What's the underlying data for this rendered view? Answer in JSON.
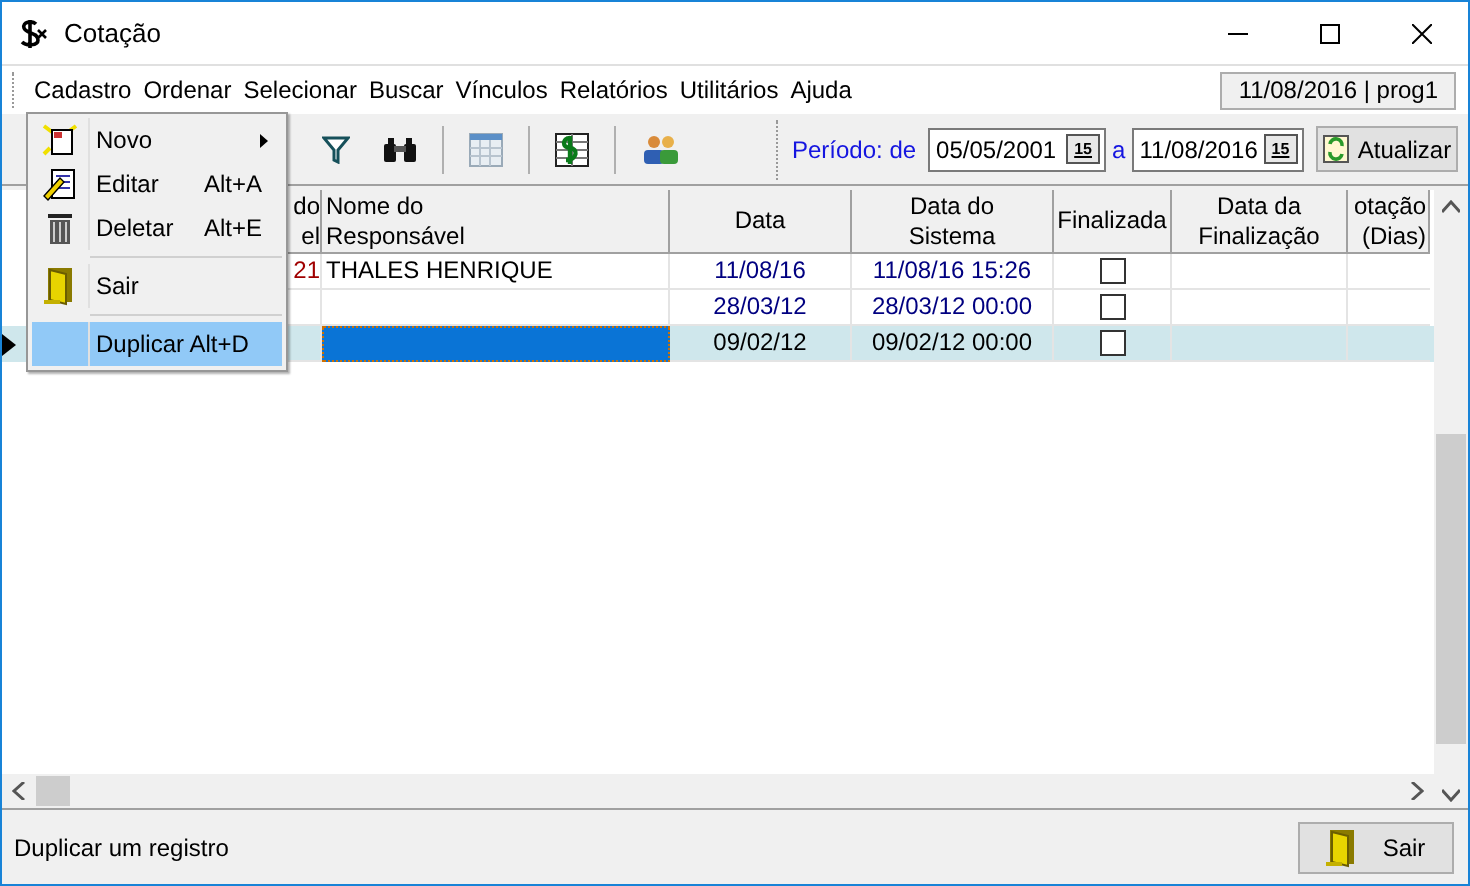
{
  "window": {
    "title": "Cotação"
  },
  "menu_bar": [
    {
      "label": "Cadastro"
    },
    {
      "label": "Ordenar"
    },
    {
      "label": "Selecionar"
    },
    {
      "label": "Buscar"
    },
    {
      "label": "Vínculos"
    },
    {
      "label": "Relatórios"
    },
    {
      "label": "Utilitários"
    },
    {
      "label": "Ajuda"
    }
  ],
  "session_label": "11/08/2016 | prog1",
  "period": {
    "label": "Período: de",
    "from": "05/05/2001",
    "from_calendar": "15",
    "separator": "a",
    "to": "11/08/2016",
    "to_calendar": "15",
    "refresh_button": "Atualizar"
  },
  "grid": {
    "columns": [
      [
        "do",
        "el"
      ],
      [
        "Nome do",
        "Responsável"
      ],
      [
        "Data"
      ],
      [
        "Data do",
        "Sistema"
      ],
      [
        "Finalizada"
      ],
      [
        "Data da",
        "Finalização"
      ],
      [
        "otação",
        "(Dias)"
      ]
    ],
    "rows": [
      {
        "current": false,
        "selected": false,
        "editing": false,
        "column_1": "21",
        "responsavel": "THALES HENRIQUE",
        "data": "11/08/16",
        "data_sistema": "11/08/16 15:26",
        "finalizada": false
      },
      {
        "current": false,
        "selected": false,
        "editing": false,
        "data": "28/03/12",
        "data_sistema": "28/03/12 00:00",
        "finalizada": false
      },
      {
        "current": true,
        "selected": true,
        "editing": true,
        "data": "09/02/12",
        "data_sistema": "09/02/12 00:00",
        "finalizada": false
      }
    ]
  },
  "dropdown_menu": [
    {
      "kind": "item",
      "label": "Novo",
      "submenu": true,
      "selected": false
    },
    {
      "kind": "item",
      "label": "Editar",
      "shortcut": "Alt+A",
      "submenu": false,
      "selected": false
    },
    {
      "kind": "item",
      "label": "Deletar",
      "shortcut": "Alt+E",
      "submenu": false,
      "selected": false
    },
    {
      "kind": "separator"
    },
    {
      "kind": "item",
      "label": "Sair",
      "submenu": false,
      "selected": false
    },
    {
      "kind": "separator"
    },
    {
      "kind": "item",
      "label": "Duplicar Alt+D",
      "submenu": false,
      "selected": true
    }
  ],
  "status_bar": {
    "text": "Duplicar um registro",
    "exit_button": "Sair"
  }
}
